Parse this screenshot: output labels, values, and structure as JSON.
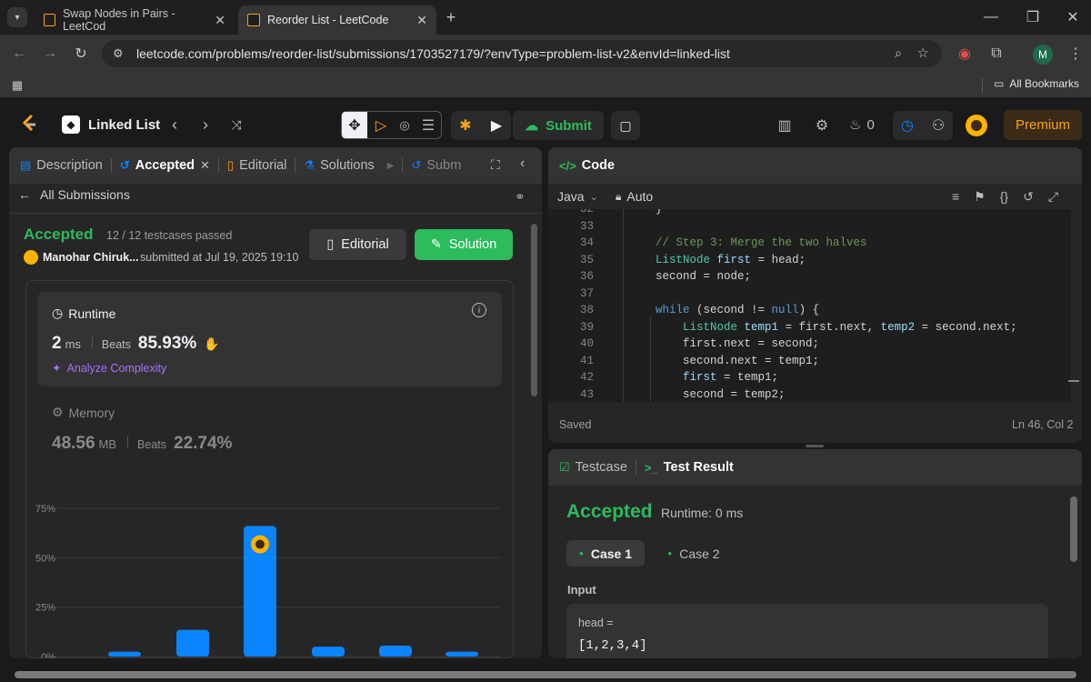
{
  "browser": {
    "tabs": [
      {
        "title": "Swap Nodes in Pairs - LeetCod",
        "active": false
      },
      {
        "title": "Reorder List - LeetCode",
        "active": true
      }
    ],
    "url": "leetcode.com/problems/reorder-list/submissions/1703527179/?envType=problem-list-v2&envId=linked-list",
    "profile_initial": "M",
    "bookmarks_label": "All Bookmarks"
  },
  "header": {
    "list_title": "Linked List",
    "submit_label": "Submit",
    "streak_count": "0",
    "premium_label": "Premium"
  },
  "left_panel": {
    "tabs": [
      "Description",
      "Accepted",
      "Editorial",
      "Solutions",
      "Subm"
    ],
    "back_label": "All Submissions",
    "status": "Accepted",
    "testcases": "12 / 12 testcases passed",
    "user": "Manohar Chiruk...",
    "submitted": "submitted at Jul 19, 2025 19:10",
    "editorial_btn": "Editorial",
    "solution_btn": "Solution",
    "runtime": {
      "label": "Runtime",
      "value": "2",
      "unit": "ms",
      "beats_label": "Beats",
      "beats": "85.93%"
    },
    "analyze_label": "Analyze Complexity",
    "memory": {
      "label": "Memory",
      "value": "48.56",
      "unit": "MB",
      "beats_label": "Beats",
      "beats": "22.74%"
    }
  },
  "chart_data": {
    "type": "bar",
    "yticks": [
      "75%",
      "50%",
      "25%",
      "0%"
    ],
    "ylim": [
      0,
      75
    ],
    "values": [
      2.5,
      13.5,
      66,
      5,
      5.5,
      2.5
    ],
    "highlight_index": 2,
    "color": "#0a84ff"
  },
  "code_panel": {
    "title": "Code",
    "language": "Java",
    "mode": "Auto",
    "saved": "Saved",
    "position": "Ln 46, Col 2",
    "lines": [
      {
        "n": "32",
        "t": "        }"
      },
      {
        "n": "33",
        "t": ""
      },
      {
        "n": "34",
        "t": "        // Step 3: Merge the two halves"
      },
      {
        "n": "35",
        "t": "        ListNode first = head;"
      },
      {
        "n": "36",
        "t": "        second = node;"
      },
      {
        "n": "37",
        "t": ""
      },
      {
        "n": "38",
        "t": "        while (second != null) {"
      },
      {
        "n": "39",
        "t": "            ListNode temp1 = first.next, temp2 = second.next;"
      },
      {
        "n": "40",
        "t": "            first.next = second;"
      },
      {
        "n": "41",
        "t": "            second.next = temp1;"
      },
      {
        "n": "42",
        "t": "            first = temp1;"
      },
      {
        "n": "43",
        "t": "            second = temp2;"
      }
    ]
  },
  "test_panel": {
    "tab_testcase": "Testcase",
    "tab_result": "Test Result",
    "status": "Accepted",
    "runtime": "Runtime: 0 ms",
    "cases": [
      "Case 1",
      "Case 2"
    ],
    "input_label": "Input",
    "var_name": "head =",
    "var_value": "[1,2,3,4]"
  }
}
